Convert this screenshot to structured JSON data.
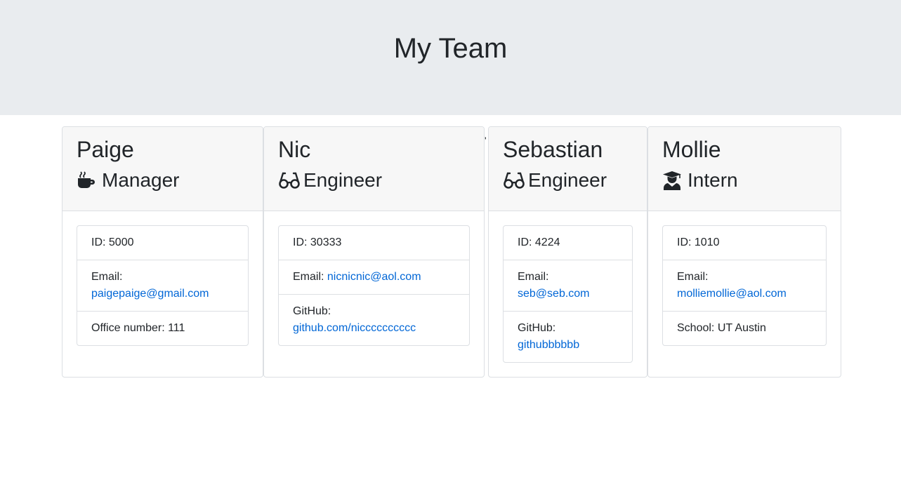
{
  "header": {
    "title": "My Team"
  },
  "stray_mark": "'",
  "employees": [
    {
      "name": "Paige",
      "role": "Manager",
      "role_icon": "coffee-icon",
      "id_text": "ID: 5000",
      "email_label": "Email:",
      "email": "paigepaige@gmail.com",
      "extra_text": "Office number: 111"
    },
    {
      "name": "Nic",
      "role": "Engineer",
      "role_icon": "glasses-icon",
      "id_text": "ID: 30333",
      "email_label": "Email:",
      "email": "nicnicnic@aol.com",
      "extra_label": "GitHub:",
      "extra_link": "github.com/nicccccccccc"
    },
    {
      "name": "Sebastian",
      "role": "Engineer",
      "role_icon": "glasses-icon",
      "id_text": "ID: 4224",
      "email_label": "Email:",
      "email": "seb@seb.com",
      "extra_label": "GitHub:",
      "extra_link": "githubbbbbb"
    },
    {
      "name": "Mollie",
      "role": "Intern",
      "role_icon": "graduate-icon",
      "id_text": "ID: 1010",
      "email_label": "Email:",
      "email": "molliemollie@aol.com",
      "extra_text": "School: UT Austin"
    }
  ]
}
